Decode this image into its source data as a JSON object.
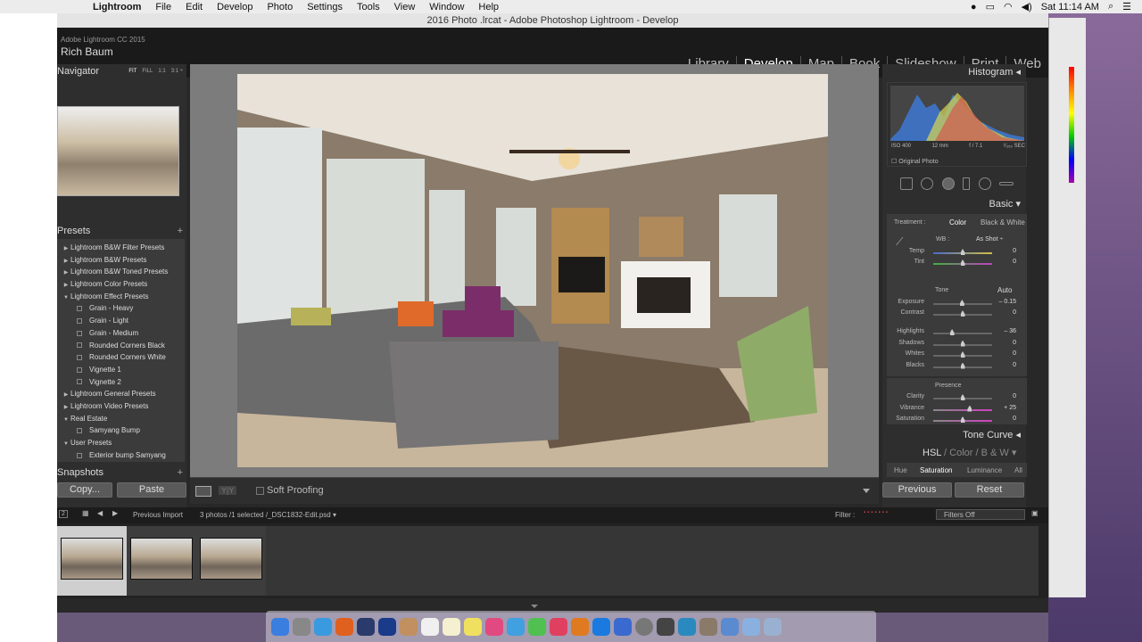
{
  "menubar": {
    "app": "Lightroom",
    "items": [
      "File",
      "Edit",
      "Develop",
      "Photo",
      "Settings",
      "Tools",
      "View",
      "Window",
      "Help"
    ],
    "clock": "Sat 11:14 AM"
  },
  "window": {
    "title": "2016 Photo .lrcat - Adobe Photoshop Lightroom - Develop"
  },
  "identity": {
    "product": "Adobe Lightroom CC 2015",
    "user": "Rich Baum"
  },
  "modules": [
    "Library",
    "Develop",
    "Map",
    "Book",
    "Slideshow",
    "Print",
    "Web"
  ],
  "active_module": "Develop",
  "left_panel": {
    "navigator_title": "Navigator",
    "zoom_options": [
      "FIT",
      "FILL",
      "1:1",
      "3:1 ÷"
    ],
    "presets_title": "Presets",
    "presets": [
      {
        "label": "Lightroom B&W Filter Presets",
        "type": "folder",
        "open": false
      },
      {
        "label": "Lightroom B&W Presets",
        "type": "folder",
        "open": false
      },
      {
        "label": "Lightroom B&W Toned Presets",
        "type": "folder",
        "open": false
      },
      {
        "label": "Lightroom Color Presets",
        "type": "folder",
        "open": false
      },
      {
        "label": "Lightroom Effect Presets",
        "type": "folder",
        "open": true
      },
      {
        "label": "Grain - Heavy",
        "type": "item"
      },
      {
        "label": "Grain - Light",
        "type": "item"
      },
      {
        "label": "Grain - Medium",
        "type": "item"
      },
      {
        "label": "Rounded Corners Black",
        "type": "item"
      },
      {
        "label": "Rounded Corners White",
        "type": "item"
      },
      {
        "label": "Vignette 1",
        "type": "item"
      },
      {
        "label": "Vignette 2",
        "type": "item"
      },
      {
        "label": "Lightroom General Presets",
        "type": "folder",
        "open": false
      },
      {
        "label": "Lightroom Video Presets",
        "type": "folder",
        "open": false
      },
      {
        "label": "Real Estate",
        "type": "folder",
        "open": true
      },
      {
        "label": "Samyang Bump",
        "type": "item"
      },
      {
        "label": "User Presets",
        "type": "folder",
        "open": true
      },
      {
        "label": "Exterior bump Samyang",
        "type": "item"
      }
    ],
    "snapshots_title": "Snapshots",
    "copy_label": "Copy...",
    "paste_label": "Paste"
  },
  "toolbar": {
    "view_mode": "Y|Y",
    "soft_proofing_label": "Soft Proofing"
  },
  "right_panel": {
    "histogram_title": "Histogram",
    "iso": "ISO 400",
    "focal": "12 mm",
    "aperture": "f / 7.1",
    "shutter": "¹⁄₂₅₀ SEC",
    "original_photo_label": "Original Photo",
    "basic_title": "Basic",
    "treatment_label": "Treatment :",
    "treatment_color": "Color",
    "treatment_bw": "Black & White",
    "wb_label": "WB :",
    "wb_value": "As Shot ÷",
    "wb_sliders": [
      {
        "label": "Temp",
        "value": "0",
        "pos": 0.5
      },
      {
        "label": "Tint",
        "value": "0",
        "pos": 0.5
      }
    ],
    "tone_label": "Tone",
    "auto_label": "Auto",
    "tone_sliders": [
      {
        "label": "Exposure",
        "value": "– 0.15",
        "pos": 0.49
      },
      {
        "label": "Contrast",
        "value": "0",
        "pos": 0.5
      }
    ],
    "tone_sliders2": [
      {
        "label": "Highlights",
        "value": "– 36",
        "pos": 0.32
      },
      {
        "label": "Shadows",
        "value": "0",
        "pos": 0.5
      },
      {
        "label": "Whites",
        "value": "0",
        "pos": 0.5
      },
      {
        "label": "Blacks",
        "value": "0",
        "pos": 0.5
      }
    ],
    "presence_label": "Presence",
    "presence_sliders": [
      {
        "label": "Clarity",
        "value": "0",
        "pos": 0.5
      },
      {
        "label": "Vibrance",
        "value": "+ 25",
        "pos": 0.62
      },
      {
        "label": "Saturation",
        "value": "0",
        "pos": 0.5
      }
    ],
    "tone_curve_title": "Tone Curve",
    "hsl_tabs": [
      "HSL",
      "Color",
      "B & W"
    ],
    "hsl_subtabs": [
      "Hue",
      "Saturation",
      "Luminance",
      "All"
    ],
    "previous_label": "Previous",
    "reset_label": "Reset"
  },
  "filmstrip": {
    "source": "Previous Import",
    "info": "3 photos /1 selected /_DSC1832-Edit.psd ▾",
    "filter_label": "Filter :",
    "filter_value": "Filters Off",
    "page_num": "2",
    "thumb_count": 3,
    "selected_index": 0
  },
  "colors": {
    "panel": "#2e2e2e",
    "panel_body": "#3b3b3b",
    "center_bg": "#7c7c7c",
    "identity_bg": "#1a1a1a"
  }
}
